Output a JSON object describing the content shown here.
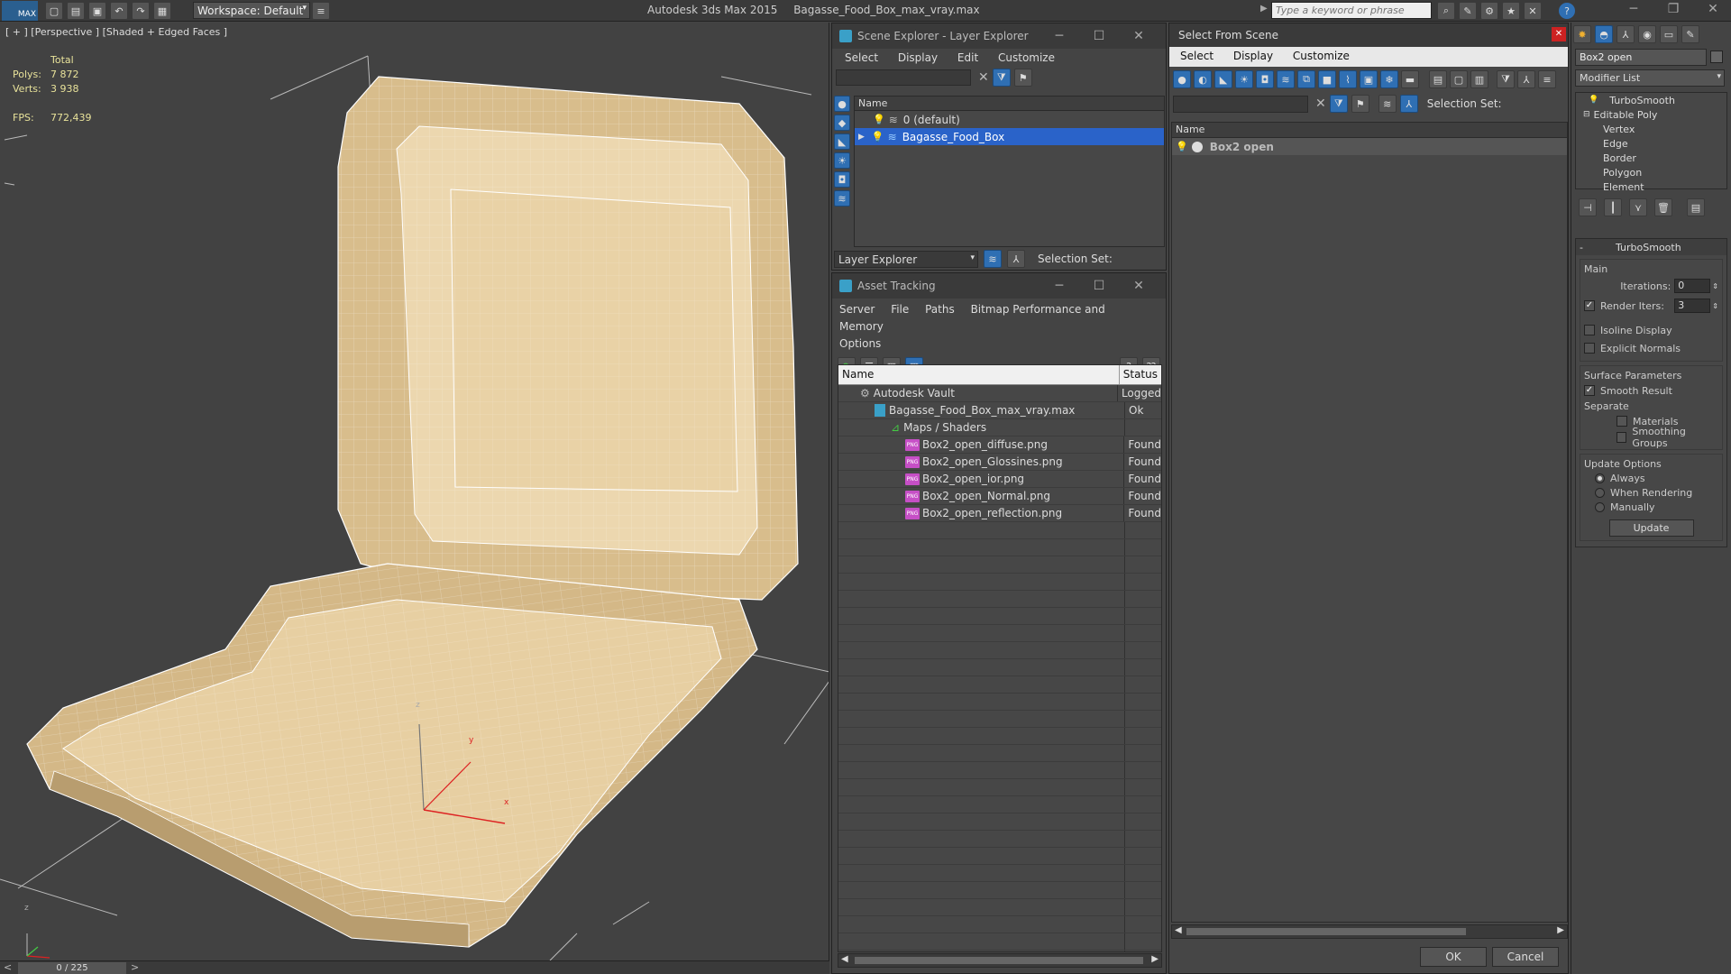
{
  "app": {
    "title": "Autodesk 3ds Max  2015",
    "file": "Bagasse_Food_Box_max_vray.max",
    "workspace": "Workspace: Default",
    "search_placeholder": "Type a keyword or phrase",
    "logo": "MAX"
  },
  "viewport": {
    "label": "[ + ] [Perspective ] [Shaded + Edged Faces ]",
    "stats": {
      "total_label": "Total",
      "polys_label": "Polys:",
      "polys_value": "7 872",
      "verts_label": "Verts:",
      "verts_value": "3 938",
      "fps_label": "FPS:",
      "fps_value": "772,439"
    },
    "axis": {
      "x": "x",
      "y": "y",
      "z": "z"
    }
  },
  "timeline": {
    "frame": "0 / 225",
    "prev": "<",
    "next": ">"
  },
  "scene_explorer": {
    "title": "Scene Explorer - Layer Explorer",
    "menu": [
      "Select",
      "Display",
      "Edit",
      "Customize"
    ],
    "column_name": "Name",
    "layers": [
      {
        "name": "0 (default)",
        "selected": false
      },
      {
        "name": "Bagasse_Food_Box",
        "selected": true
      }
    ],
    "footer_dropdown": "Layer Explorer",
    "selection_set_label": "Selection Set:"
  },
  "asset_tracking": {
    "title": "Asset Tracking",
    "menu": [
      "Server",
      "File",
      "Paths",
      "Bitmap Performance and Memory"
    ],
    "menu2": [
      "Options"
    ],
    "col_name": "Name",
    "col_status": "Status",
    "rows": [
      {
        "name": "Autodesk Vault",
        "status": "Logged",
        "indent": 0,
        "icon": "vault-icon"
      },
      {
        "name": "Bagasse_Food_Box_max_vray.max",
        "status": "Ok",
        "indent": 1,
        "icon": "max-file-icon"
      },
      {
        "name": "Maps / Shaders",
        "status": "",
        "indent": 2,
        "icon": "maps-icon"
      },
      {
        "name": "Box2_open_diffuse.png",
        "status": "Found",
        "indent": 3,
        "icon": "png-icon"
      },
      {
        "name": "Box2_open_Glossines.png",
        "status": "Found",
        "indent": 3,
        "icon": "png-icon"
      },
      {
        "name": "Box2_open_ior.png",
        "status": "Found",
        "indent": 3,
        "icon": "png-icon"
      },
      {
        "name": "Box2_open_Normal.png",
        "status": "Found",
        "indent": 3,
        "icon": "png-icon"
      },
      {
        "name": "Box2_open_reflection.png",
        "status": "Found",
        "indent": 3,
        "icon": "png-icon"
      }
    ],
    "png_badge": "PNG"
  },
  "select_from_scene": {
    "title": "Select From Scene",
    "menu": [
      "Select",
      "Display",
      "Customize"
    ],
    "selection_set_label": "Selection Set:",
    "column_name": "Name",
    "objects": [
      "Box2 open"
    ],
    "ok": "OK",
    "cancel": "Cancel"
  },
  "command_panel": {
    "object_name": "Box2 open",
    "modifier_list": "Modifier List",
    "stack": [
      {
        "name": "TurboSmooth",
        "level": 0
      },
      {
        "name": "Editable Poly",
        "level": 0
      },
      {
        "name": "Vertex",
        "level": 1
      },
      {
        "name": "Edge",
        "level": 1
      },
      {
        "name": "Border",
        "level": 1
      },
      {
        "name": "Polygon",
        "level": 1
      },
      {
        "name": "Element",
        "level": 1
      }
    ],
    "rollout_title": "TurboSmooth",
    "main_label": "Main",
    "iterations_label": "Iterations:",
    "iterations_value": "0",
    "render_iters_label": "Render Iters:",
    "render_iters_value": "3",
    "isoline_label": "Isoline Display",
    "explicit_normals_label": "Explicit Normals",
    "surface_params_label": "Surface Parameters",
    "smooth_result_label": "Smooth Result",
    "separate_label": "Separate",
    "materials_label": "Materials",
    "smoothing_groups_label": "Smoothing Groups",
    "update_options_label": "Update Options",
    "always_label": "Always",
    "when_rendering_label": "When Rendering",
    "manually_label": "Manually",
    "update_button": "Update",
    "collapse": "-"
  },
  "colors": {
    "accent": "#2f6fb3",
    "selection": "#2a63c9",
    "viewport_bg": "#424242",
    "model": "#e8cfa3",
    "stats_text": "#e8e29a"
  }
}
